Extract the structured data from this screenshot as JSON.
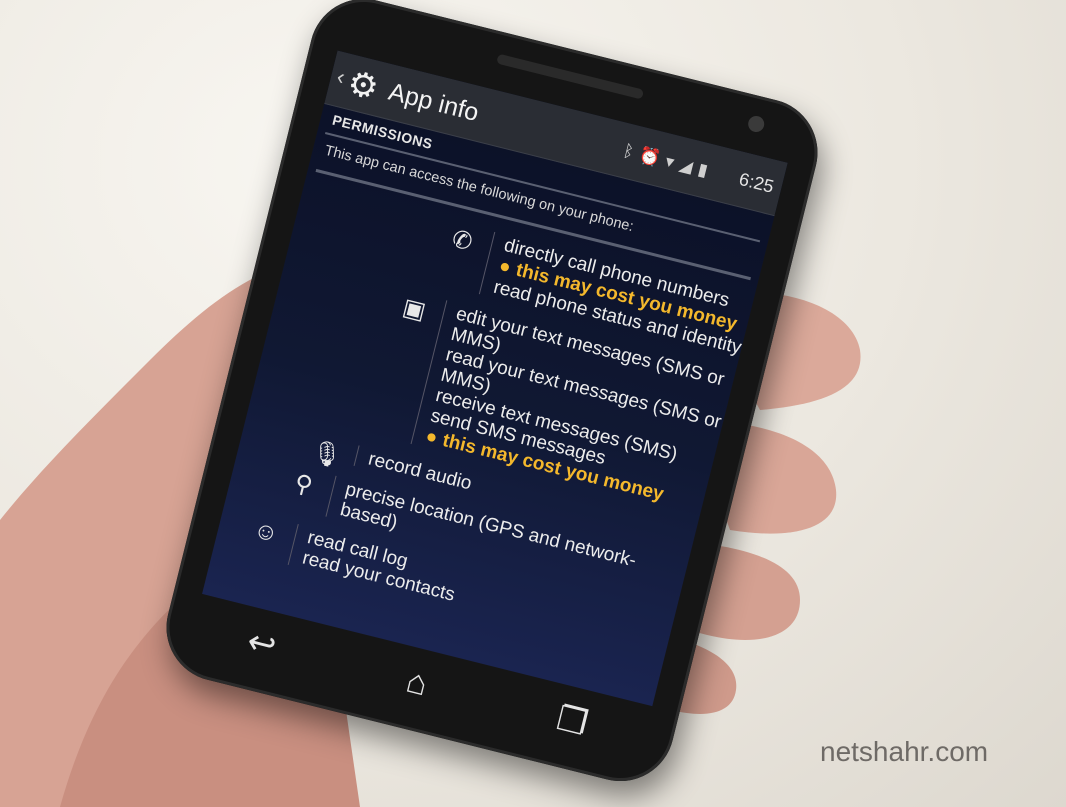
{
  "status_bar": {
    "time": "6:25"
  },
  "action_bar": {
    "title": "App info"
  },
  "permissions": {
    "header": "PERMISSIONS",
    "intro": "This app can access the following on your phone:",
    "groups": [
      {
        "icon": "phone-icon",
        "items": [
          "directly call phone numbers"
        ],
        "warning": "this may cost you money",
        "extra": [
          "read phone status and identity"
        ]
      },
      {
        "icon": "message-icon",
        "items": [
          "edit your text messages (SMS or MMS)",
          "read your text messages (SMS or MMS)",
          "receive text messages (SMS)",
          "send SMS messages"
        ],
        "warning": "this may cost you money"
      },
      {
        "icon": "microphone-icon",
        "items": [
          "record audio"
        ]
      },
      {
        "icon": "location-pin-icon",
        "items": [
          "precise location (GPS and network-based)"
        ]
      },
      {
        "icon": "people-icon",
        "items": [
          "read call log",
          "read your contacts"
        ]
      }
    ]
  },
  "watermark": "netshahr.com"
}
